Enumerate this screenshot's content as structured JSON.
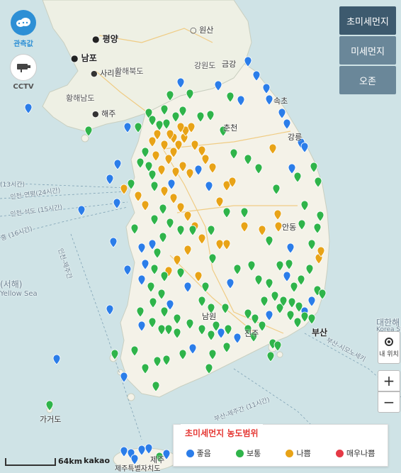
{
  "colors": {
    "good": "#2b7de9",
    "normal": "#2fb44a",
    "bad": "#e8a317",
    "very_bad": "#e53945",
    "sea": "#cfe3e6",
    "land": "#f3f1e8"
  },
  "left_buttons": [
    {
      "icon": "cloud-icon",
      "label": "관측값"
    },
    {
      "icon": "cctv-icon",
      "label": "CCTV"
    }
  ],
  "tabs": [
    {
      "label": "초미세먼지",
      "active": true
    },
    {
      "label": "미세먼지",
      "active": false
    },
    {
      "label": "오존",
      "active": false
    }
  ],
  "controls": {
    "my_location": "내 위치",
    "zoom_in": "+",
    "zoom_out": "−"
  },
  "legend": {
    "title": "초미세먼지 농도범위",
    "items": [
      {
        "label": "좋음",
        "level": "good"
      },
      {
        "label": "보통",
        "level": "normal"
      },
      {
        "label": "나쁨",
        "level": "bad"
      },
      {
        "label": "매우나쁨",
        "level": "very_bad"
      }
    ]
  },
  "scale": {
    "label": "64km",
    "brand": "kakao"
  },
  "map_labels": {
    "pyongyang": "평양",
    "nampo": "남포",
    "sariwon": "사리원",
    "hwanghaebuk": "황해북도",
    "hwanghaenam": "황해남도",
    "haeju": "해주",
    "wonsan": "원산",
    "gangwon_n": "강원도",
    "geumgang": "금강",
    "sokcho": "속초",
    "chuncheon": "춘천",
    "gangneung": "강릉",
    "andong": "안동",
    "jinju": "진주",
    "busan": "부산",
    "namwon": "남원",
    "yellow_sea": "(서해)",
    "yellow_sea_en": "Yellow Sea",
    "korea_strait": "대한해",
    "korea_strait_en": "Korea St",
    "gageodo": "가거도",
    "jeju": "제주",
    "jeju_special": "제주특별자치도",
    "route1": "인천-제주간",
    "route2": "부산-시모노세키",
    "route3": "부산-제주간 (11시간)",
    "route4": "인천-연평(24시간)",
    "route5": "인천-석도 (15시간)",
    "route6": "홍 (16시간)",
    "route7": "인천-제주간",
    "route8": "(13시간)"
  }
}
